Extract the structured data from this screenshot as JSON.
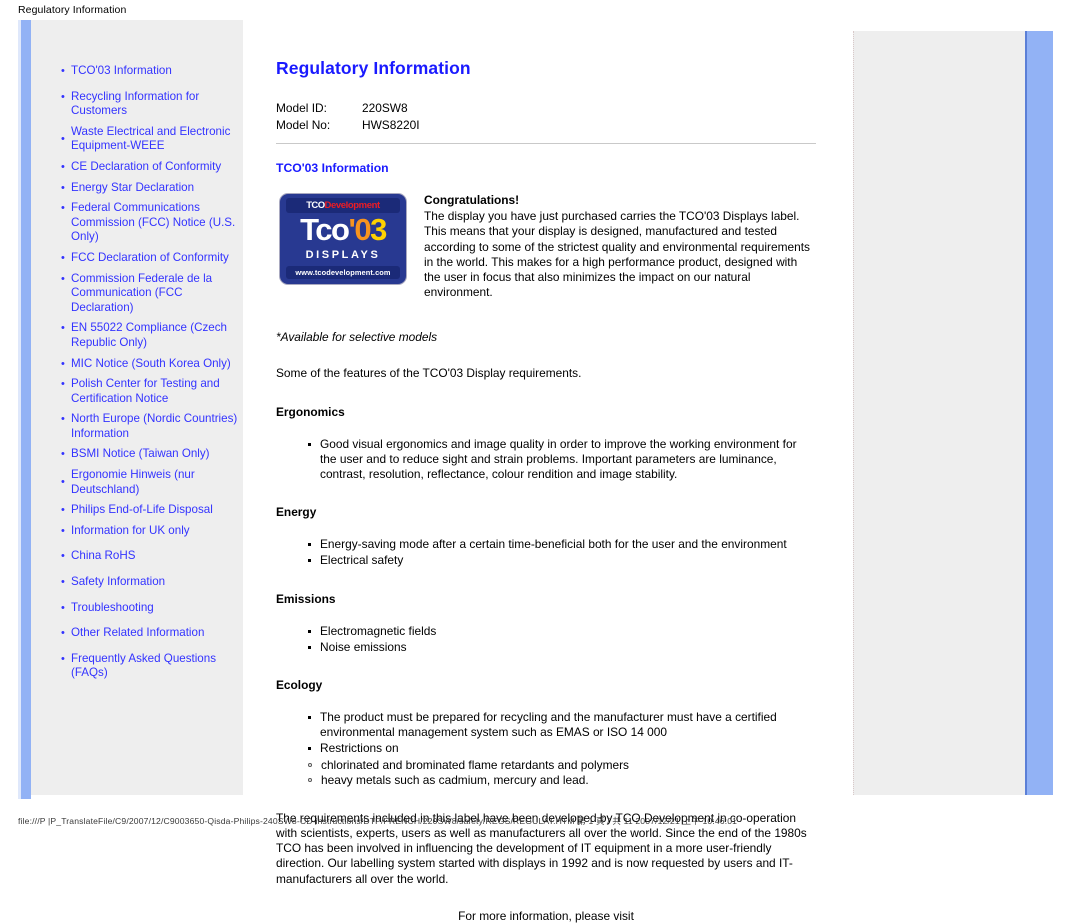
{
  "window": {
    "doc_title": "Regulatory Information"
  },
  "sidebar": {
    "items": [
      {
        "label": "TCO'03 Information",
        "bullet": "•"
      },
      {
        "label": "Recycling Information for Customers",
        "bullet": "•"
      },
      {
        "label": "Waste Electrical and Electronic Equipment-WEEE",
        "bullet": "•"
      },
      {
        "label": "CE Declaration of Conformity",
        "bullet": "•"
      },
      {
        "label": "Energy Star Declaration",
        "bullet": "•"
      },
      {
        "label": "Federal Communications Commission (FCC) Notice (U.S. Only)",
        "bullet": "•"
      },
      {
        "label": "FCC Declaration of Conformity",
        "bullet": "•"
      },
      {
        "label": "Commission Federale de la Communication (FCC Declaration)",
        "bullet": "•"
      },
      {
        "label": "EN 55022 Compliance (Czech Republic Only)",
        "bullet": "•"
      },
      {
        "label": "MIC Notice (South Korea Only)",
        "bullet": "•"
      },
      {
        "label": "Polish Center for Testing and Certification Notice",
        "bullet": "•"
      },
      {
        "label": "North Europe (Nordic Countries) Information",
        "bullet": "•"
      },
      {
        "label": "BSMI Notice (Taiwan Only)",
        "bullet": "•"
      },
      {
        "label": "Ergonomie Hinweis (nur Deutschland)",
        "bullet": "•"
      },
      {
        "label": "Philips End-of-Life Disposal",
        "bullet": "•"
      },
      {
        "label": "Information for UK only",
        "bullet": "•"
      },
      {
        "label": "China RoHS",
        "bullet": "•"
      },
      {
        "label": "Safety Information",
        "bullet": "•"
      },
      {
        "label": "Troubleshooting",
        "bullet": "•"
      },
      {
        "label": "Other Related Information",
        "bullet": "•"
      },
      {
        "label": "Frequently Asked Questions (FAQs)",
        "bullet": "•"
      }
    ]
  },
  "main": {
    "heading": "Regulatory Information",
    "model": {
      "id_label": "Model ID:",
      "id_value": "220SW8",
      "no_label": "Model No:",
      "no_value": "HWS8220I"
    },
    "section_heading": "TCO'03 Information",
    "logo": {
      "top_part1": "TCO",
      "top_part2": "Development",
      "big_tco": "Tco",
      "big_apostrophe": "'",
      "big_zero": "0",
      "big_three": "3",
      "displays": "DISPLAYS",
      "url": "www.tcodevelopment.com"
    },
    "congrats": {
      "title": "Congratulations!",
      "body": "The display you have just purchased carries the TCO'03 Displays label. This means that your display is designed, manufactured and tested according to some of the strictest quality and environmental requirements in the world. This makes for a high performance product, designed with the user in focus that also minimizes the impact on our natural environment."
    },
    "available_note": "*Available for selective models",
    "features_intro": "Some of the features of the TCO'03 Display requirements.",
    "sections": [
      {
        "title": "Ergonomics",
        "bullets": [
          "Good visual ergonomics and image quality in order to improve the working environment for the user and to reduce sight and strain problems. Important parameters are luminance, contrast, resolution, reflectance, colour rendition and image stability."
        ]
      },
      {
        "title": "Energy",
        "bullets": [
          "Energy-saving mode after a certain time-beneficial both for the user and the environment",
          "Electrical safety"
        ]
      },
      {
        "title": "Emissions",
        "bullets": [
          "Electromagnetic fields",
          "Noise emissions"
        ]
      },
      {
        "title": "Ecology",
        "bullets": [
          "The product must be prepared for recycling and the manufacturer must have a certified environmental management system such as EMAS or ISO 14 000",
          "Restrictions on"
        ],
        "subbullets": [
          "chlorinated and brominated flame retardants and polymers",
          "heavy metals such as cadmium, mercury and lead."
        ]
      }
    ],
    "closing_paragraph": "The requirements included in this label have been developed by TCO Development in co-operation with scientists, experts, users as well as manufacturers all over the world. Since the end of the 1980s TCO has been involved in influencing the development of IT equipment in a more user-friendly direction. Our labelling system started with displays in 1992 and is now requested by users and IT-manufacturers all over the world.",
    "more_info": "For more information, please visit"
  },
  "statusbar": {
    "text": "file:///P |P_TranslateFile/C9/2007/12/C9003650-Qisda-Philips-240SW8-CD-instructions/DTP/FRENCH/220SW8/safety/REGS/REGULAT.HTM 第 1 頁 / 共 11 2007/12/21 上午 10:46:01"
  }
}
